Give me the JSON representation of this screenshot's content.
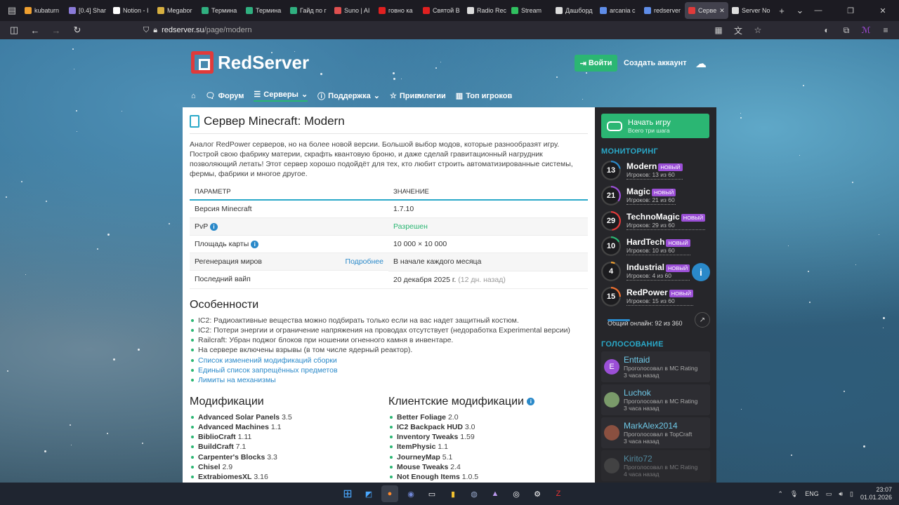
{
  "browser": {
    "tabs": [
      {
        "label": "kubaturn",
        "color": "#f0a030"
      },
      {
        "label": "[0.4] Shar",
        "color": "#8a7ad8"
      },
      {
        "label": "Notion - I",
        "color": "#ffffff"
      },
      {
        "label": "Megabor",
        "color": "#d8b040"
      },
      {
        "label": "Термина",
        "color": "#30b080"
      },
      {
        "label": "Термина",
        "color": "#30b080"
      },
      {
        "label": "Гайд по г",
        "color": "#30b080"
      },
      {
        "label": "Suno | AI",
        "color": "#e05050"
      },
      {
        "label": "говно ка",
        "color": "#e02020"
      },
      {
        "label": "Святой В",
        "color": "#e02020"
      },
      {
        "label": "Radio Rec",
        "color": "#dddddd"
      },
      {
        "label": "Stream",
        "color": "#30c060"
      },
      {
        "label": "Дашборд",
        "color": "#dddddd"
      },
      {
        "label": "arcania c",
        "color": "#5f8de8"
      },
      {
        "label": "redserver",
        "color": "#5f8de8"
      },
      {
        "label": "Серве",
        "color": "#e03a3a"
      },
      {
        "label": "Server No",
        "color": "#dddddd"
      }
    ],
    "url_domain": "redserver.su",
    "url_path": "/page/modern"
  },
  "site": {
    "logo": "RedServer",
    "login": "Войти",
    "register": "Создать аккаунт",
    "nav": [
      "Форум",
      "Серверы",
      "Поддержка",
      "Привилегии",
      "Топ игроков"
    ]
  },
  "main": {
    "title": "Сервер Minecraft: Modern",
    "intro": "Аналог RedPower серверов, но на более новой версии. Большой выбор модов, которые разнообразят игру. Построй свою фабрику материи, скрафть квантовую броню, и даже сделай гравитационный нагрудник позволяющий летать! Этот сервер хорошо подойдёт для тех, кто любит строить автоматизированные системы, фермы, фабрики и многое другое.",
    "table": {
      "headers": [
        "ПАРАМЕТР",
        "ЗНАЧЕНИЕ"
      ],
      "rows": [
        {
          "param": "Версия Minecraft",
          "value": "1.7.10"
        },
        {
          "param": "PvP",
          "value": "Разрешен"
        },
        {
          "param": "Площадь карты",
          "value": "10 000 × 10 000"
        },
        {
          "param": "Регенерация миров",
          "link": "Подробнее",
          "value": "В начале каждого месяца"
        },
        {
          "param": "Последний вайп",
          "value": "20 декабря 2025 г.",
          "extra": "(12 дн. назад)"
        }
      ]
    },
    "features_title": "Особенности",
    "features": [
      "IC2: Радиоактивные вещества можно подбирать только если на вас надет защитный костюм.",
      "IC2: Потери энергии и ограничение напряжения на проводах отсутствует (недоработка Experimental версии)",
      "Railcraft: Убран поджог блоков при ношении огненного камня в инвентаре.",
      "На сервере включены взрывы (в том числе ядерный реактор)."
    ],
    "feature_links": [
      "Список изменений модификаций сборки",
      "Единый список запрещённых предметов",
      "Лимиты на механизмы"
    ],
    "mods_title": "Модификации",
    "mods": [
      {
        "name": "Advanced Solar Panels",
        "ver": "3.5"
      },
      {
        "name": "Advanced Machines",
        "ver": "1.1"
      },
      {
        "name": "BiblioCraft",
        "ver": "1.11"
      },
      {
        "name": "BuildCraft",
        "ver": "7.1"
      },
      {
        "name": "Carpenter's Blocks",
        "ver": "3.3"
      },
      {
        "name": "Chisel",
        "ver": "2.9"
      },
      {
        "name": "ExtrabiomesXL",
        "ver": "3.16"
      }
    ],
    "client_title": "Клиентские модификации",
    "client_mods": [
      {
        "name": "Better Foliage",
        "ver": "2.0"
      },
      {
        "name": "IC2 Backpack HUD",
        "ver": "3.0"
      },
      {
        "name": "Inventory Tweaks",
        "ver": "1.59"
      },
      {
        "name": "ItemPhysic",
        "ver": "1.1"
      },
      {
        "name": "JourneyMap",
        "ver": "5.1"
      },
      {
        "name": "Mouse Tweaks",
        "ver": "2.4"
      },
      {
        "name": "Not Enough Items",
        "ver": "1.0.5"
      }
    ]
  },
  "sidebar": {
    "play_title": "Начать игру",
    "play_sub": "Всего три шага",
    "monitoring_title": "МОНИТОРИНГ",
    "badge": "НОВЫЙ",
    "servers": [
      {
        "name": "Modern",
        "online": "13",
        "players": "Игроков: 13 из 60",
        "color": "#2a89c9",
        "fill": 0.22
      },
      {
        "name": "Magic",
        "online": "21",
        "players": "Игроков: 21 из 60",
        "color": "#9b4fd6",
        "fill": 0.35
      },
      {
        "name": "TechnoMagic",
        "online": "29",
        "players": "Игроков: 29 из 60",
        "color": "#e03a3a",
        "fill": 0.48
      },
      {
        "name": "HardTech",
        "online": "10",
        "players": "Игроков: 10 из 60",
        "color": "#2bb673",
        "fill": 0.17
      },
      {
        "name": "Industrial",
        "online": "4",
        "players": "Игроков: 4 из 60",
        "color": "#f0a030",
        "fill": 0.07
      },
      {
        "name": "RedPower",
        "online": "15",
        "players": "Игроков: 15 из 60",
        "color": "#f07030",
        "fill": 0.25
      }
    ],
    "online_total": "Общий онлайн: 92 из 360",
    "voting_title": "ГОЛОСОВАНИЕ",
    "votes": [
      {
        "name": "Enttaid",
        "site": "Проголосовал в MC Rating",
        "time": "3 часа назад",
        "avatar": "E",
        "color": "#9b4fd6"
      },
      {
        "name": "Luchok",
        "site": "Проголосовал в MC Rating",
        "time": "3 часа назад",
        "avatar": "",
        "color": "#7a9a6a"
      },
      {
        "name": "MarkAlex2014",
        "site": "Проголосовал в TopCraft",
        "time": "3 часа назад",
        "avatar": "",
        "color": "#8a5040"
      },
      {
        "name": "Kirito72",
        "site": "Проголосовал в MC Rating",
        "time": "4 часа назад",
        "avatar": "",
        "color": "#555555"
      }
    ]
  },
  "taskbar": {
    "lang": "ENG",
    "time": "23:07",
    "date": "01.01.2026"
  }
}
